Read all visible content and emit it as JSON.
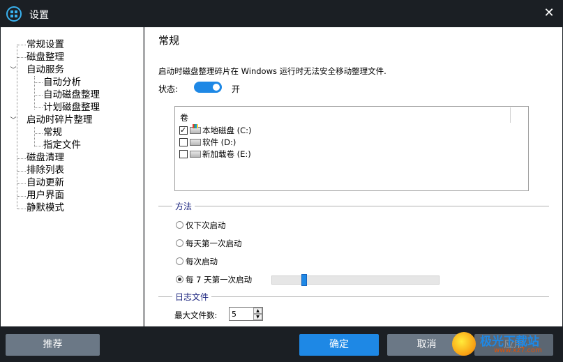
{
  "window": {
    "title": "设置",
    "close_icon": "close-icon",
    "app_icon": "defrag-logo-icon"
  },
  "tree": {
    "items": [
      {
        "label": "常规设置",
        "level": 0
      },
      {
        "label": "磁盘整理",
        "level": 0
      },
      {
        "label": "自动服务",
        "level": 0,
        "expanded": true
      },
      {
        "label": "自动分析",
        "level": 1
      },
      {
        "label": "自动磁盘整理",
        "level": 1
      },
      {
        "label": "计划磁盘整理",
        "level": 1
      },
      {
        "label": "启动时碎片整理",
        "level": 0,
        "expanded": true
      },
      {
        "label": "常规",
        "level": 1,
        "selected": true
      },
      {
        "label": "指定文件",
        "level": 1
      },
      {
        "label": "磁盘清理",
        "level": 0
      },
      {
        "label": "排除列表",
        "level": 0
      },
      {
        "label": "自动更新",
        "level": 0
      },
      {
        "label": "用户界面",
        "level": 0
      },
      {
        "label": "静默模式",
        "level": 0
      }
    ]
  },
  "content": {
    "title": "常规",
    "description": "启动时磁盘整理碎片在 Windows 运行时无法安全移动整理文件.",
    "status_label": "状态:",
    "status_value": "开",
    "status_on": true,
    "volumes": {
      "header": "卷",
      "items": [
        {
          "label": "本地磁盘 (C:)",
          "checked": true,
          "icon": "system-drive-icon"
        },
        {
          "label": "软件 (D:)",
          "checked": false,
          "icon": "drive-icon"
        },
        {
          "label": "新加载卷 (E:)",
          "checked": false,
          "icon": "drive-icon"
        }
      ]
    },
    "method": {
      "label": "方法",
      "options": [
        {
          "label": "仅下次启动",
          "checked": false
        },
        {
          "label": "每天第一次启动",
          "checked": false
        },
        {
          "label": "每次启动",
          "checked": false
        },
        {
          "label": "每 7 天第一次启动",
          "checked": true
        }
      ],
      "slider_value_fraction": 0.18
    },
    "log": {
      "label": "日志文件",
      "max_files_label": "最大文件数:",
      "max_files_value": "5"
    }
  },
  "footer": {
    "recommend": "推荐",
    "ok": "确定",
    "cancel": "取消",
    "apply": "应用"
  },
  "watermark": {
    "text": "极光下载站",
    "sub": "www.xz7.com"
  },
  "colors": {
    "accent": "#1e88e5",
    "titlebar": "#1b1f24",
    "button_gray": "#6b7886"
  }
}
